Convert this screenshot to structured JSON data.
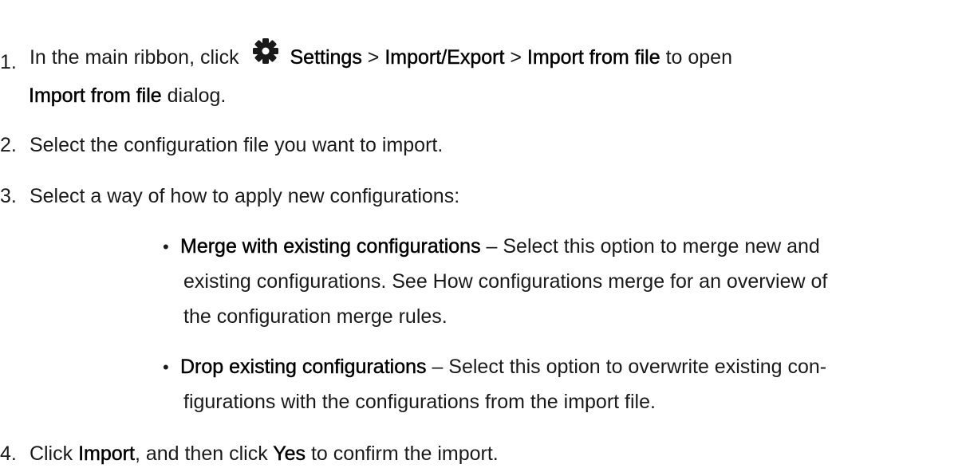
{
  "steps": {
    "s1": {
      "num": "1.",
      "pre": "In the main ribbon, click",
      "settings": "Settings",
      "sep1": ">",
      "import_export": "Import/Export",
      "sep2": ">",
      "import_from_file": "Import from file",
      "to_open": "to open",
      "dialog_name": "Import from file",
      "dialog": "dialog."
    },
    "s2": {
      "num": "2.",
      "text": "Select the configuration file you want to import."
    },
    "s3": {
      "num": "3.",
      "text": "Select a way of how to apply new configurations:",
      "options": [
        {
          "bullet": "•",
          "title": "Merge with existing configurations",
          "line1": " – Select this option to merge new and",
          "line2": "existing configurations. See How configurations merge for an overview of",
          "line3": "the configuration merge rules."
        },
        {
          "bullet": "•",
          "title": "Drop existing configurations",
          "line1": " – Select this option to overwrite existing con-",
          "line2": "figurations with the configurations from the import file."
        }
      ]
    },
    "s4": {
      "num": "4.",
      "pre": "Click",
      "import": "Import",
      "mid": ", and then click",
      "yes": "Yes",
      "post": "to confirm the import."
    }
  },
  "icons": {
    "settings": "gear-icon"
  },
  "colors": {
    "text": "#1a1a1a",
    "icon": "#1a1a1a"
  }
}
